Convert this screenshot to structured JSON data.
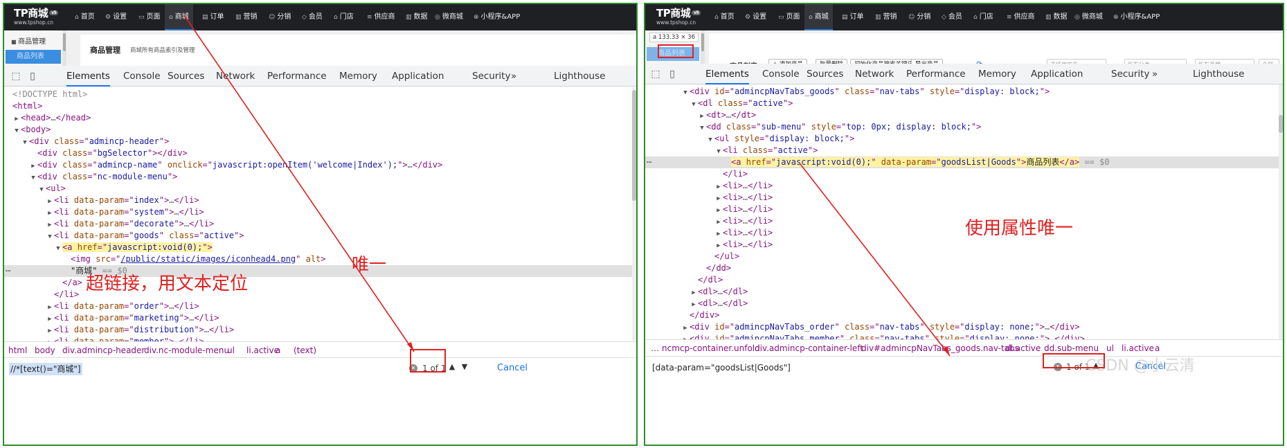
{
  "left": {
    "logo": {
      "name": "TP商城",
      "ver": "v5",
      "site": "www.tpshop.cn"
    },
    "nav": [
      {
        "label": "首页",
        "icon": "home-icon"
      },
      {
        "label": "设置",
        "icon": "gear-icon"
      },
      {
        "label": "页面",
        "icon": "page-icon"
      },
      {
        "label": "商城",
        "icon": "shop-icon"
      },
      {
        "label": "订单",
        "icon": "order-icon"
      },
      {
        "label": "营销",
        "icon": "chart-icon"
      },
      {
        "label": "分销",
        "icon": "users-icon"
      },
      {
        "label": "会员",
        "icon": "diamond-icon"
      },
      {
        "label": "门店",
        "icon": "store-icon"
      },
      {
        "label": "供应商",
        "icon": "supplier-icon"
      },
      {
        "label": "数据",
        "icon": "data-icon"
      },
      {
        "label": "微商城",
        "icon": "wechat-icon"
      },
      {
        "label": "小程序&APP",
        "icon": "miniapp-icon"
      }
    ],
    "sidebar_header": "商品管理",
    "sidebar_active": "商品列表",
    "page_title": "商品管理",
    "page_subtitle": "商城所有商品索引及管理",
    "tabs": [
      "Elements",
      "Console",
      "Sources",
      "Network",
      "Performance",
      "Memory",
      "Application",
      "Security",
      "Lighthouse"
    ],
    "more_tabs": "»",
    "breadcrumbs": [
      "html",
      "body",
      "div.admincp-header",
      "div.nc-module-menu",
      "ul",
      "li.active",
      "a",
      "(text)"
    ],
    "search_query": "//*[text()=\"商城\"]",
    "search_count": "1 of 1",
    "cancel": "Cancel",
    "annotation_text": "超链接，用文本定位",
    "annotation_unique": "唯一"
  },
  "right": {
    "logo": {
      "name": "TP商城",
      "ver": "v5",
      "site": "www.tpshop.cn"
    },
    "nav": [
      {
        "label": "首页",
        "icon": "home-icon"
      },
      {
        "label": "设置",
        "icon": "gear-icon"
      },
      {
        "label": "页面",
        "icon": "page-icon"
      },
      {
        "label": "商城",
        "icon": "shop-icon"
      },
      {
        "label": "订单",
        "icon": "order-icon"
      },
      {
        "label": "营销",
        "icon": "chart-icon"
      },
      {
        "label": "分销",
        "icon": "users-icon"
      },
      {
        "label": "会员",
        "icon": "diamond-icon"
      },
      {
        "label": "门店",
        "icon": "store-icon"
      },
      {
        "label": "供应商",
        "icon": "supplier-icon"
      },
      {
        "label": "数据",
        "icon": "data-icon"
      },
      {
        "label": "微商城",
        "icon": "wechat-icon"
      },
      {
        "label": "小程序&APP",
        "icon": "miniapp-icon"
      }
    ],
    "dim_tip": "a  133.33 × 36",
    "sidebar_active": "商品列表",
    "list_title": "商品列表",
    "toolbar": [
      "+ 添加商品",
      "批量删除",
      "初始化商品搜索关键词",
      "导出商品"
    ],
    "refresh_icon": "⟳",
    "selects": [
      "选择供应商",
      "所有分类",
      "所有品牌",
      "全部"
    ],
    "tabs": [
      "Elements",
      "Console",
      "Sources",
      "Network",
      "Performance",
      "Memory",
      "Application",
      "Security",
      "Lighthouse"
    ],
    "more_tabs": "»",
    "breadcrumbs": [
      "…",
      "ncmcp-container.unfold",
      "div.admincp-container-left",
      "div#admincpNavTabs_goods.nav-tabs",
      "dl.active",
      "dd.sub-menu",
      "ul",
      "li.active",
      "a"
    ],
    "search_query": "[data-param=\"goodsList|Goods\"]",
    "search_count": "1 of 1",
    "cancel": "Cancel",
    "watermark": "CSDN @小云清",
    "annotation_text": "使用属性唯一"
  }
}
